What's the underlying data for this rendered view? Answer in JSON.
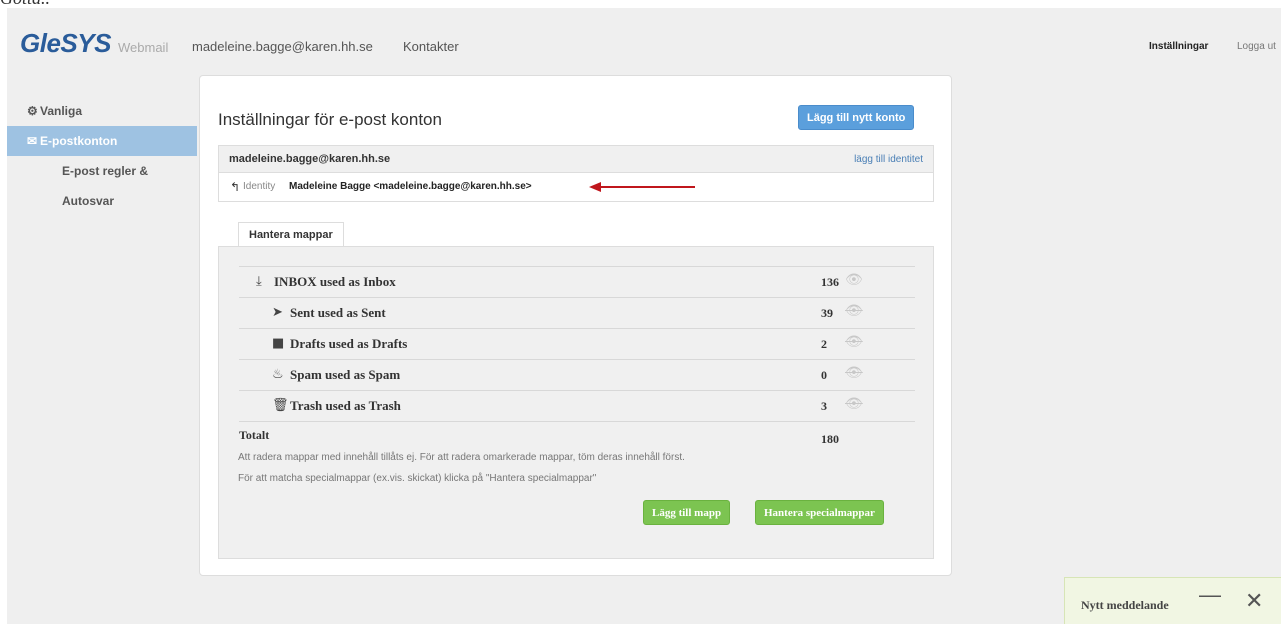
{
  "cropped_top_text": "Gotta..",
  "header": {
    "logo": "GleSYS",
    "logo_sub": "Webmail",
    "user_email": "madeleine.bagge@karen.hh.se",
    "contacts": "Kontakter",
    "settings": "Inställningar",
    "logout": "Logga ut"
  },
  "sidebar": {
    "items": [
      {
        "label": "Vanliga",
        "icon": "gear-icon"
      },
      {
        "label": "E-postkonton",
        "icon": "envelope-icon"
      },
      {
        "label": "E-post regler & Autosvar"
      }
    ]
  },
  "main": {
    "title": "Inställningar för e-post konton",
    "add_account_button": "Lägg till nytt konto",
    "account": {
      "email": "madeleine.bagge@karen.hh.se",
      "add_identity": "lägg till identitet",
      "identity_label": "Identity",
      "identity_value": "Madeleine Bagge <madeleine.bagge@karen.hh.se>"
    },
    "tab": "Hantera mappar",
    "folders": [
      {
        "name": "INBOX used as Inbox",
        "count": "136",
        "icon": "inbox-download-icon",
        "visible": true
      },
      {
        "name": "Sent used as Sent",
        "count": "39",
        "icon": "paper-plane-icon",
        "visible": false
      },
      {
        "name": "Drafts used as Drafts",
        "count": "2",
        "icon": "document-icon",
        "visible": false
      },
      {
        "name": "Spam used as Spam",
        "count": "0",
        "icon": "fire-icon",
        "visible": false
      },
      {
        "name": "Trash used as Trash",
        "count": "3",
        "icon": "trash-icon",
        "visible": false
      }
    ],
    "total_label": "Totalt",
    "total_count": "180",
    "help_text_1": "Att radera mappar med innehåll tillåts ej. För att radera omarkerade mappar, töm deras innehåll först.",
    "help_text_2": "För att matcha specialmappar (ex.vis. skickat) klicka på \"Hantera specialmappar\"",
    "add_folder_button": "Lägg till mapp",
    "special_folders_button": "Hantera specialmappar"
  },
  "notification": {
    "label": "Nytt meddelande"
  },
  "colors": {
    "accent_blue": "#5b9fdc",
    "accent_green": "#7cc451",
    "arrow_red": "#c0161c",
    "sidebar_active": "#9ec2e2"
  }
}
